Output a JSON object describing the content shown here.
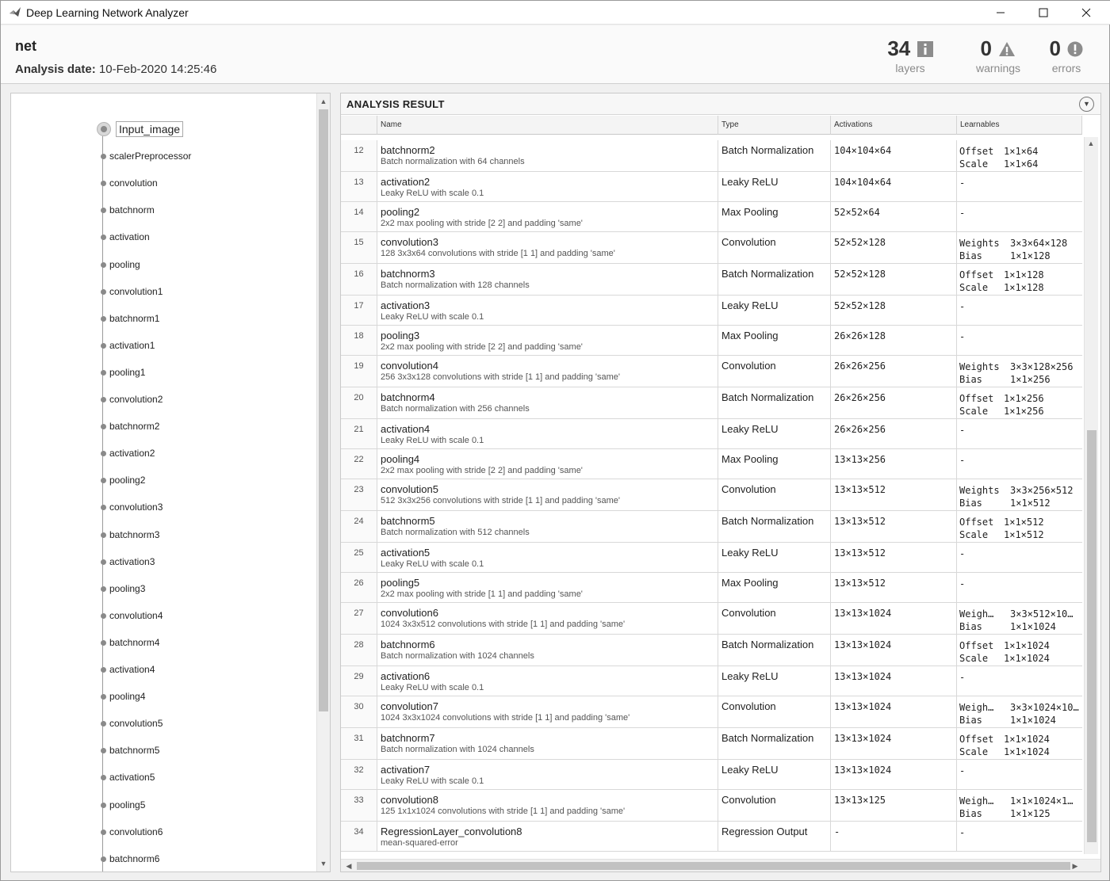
{
  "window": {
    "title": "Deep Learning Network Analyzer"
  },
  "header": {
    "net_name": "net",
    "analysis_date_label": "Analysis date:",
    "analysis_date": "10-Feb-2020 14:25:46",
    "stats": {
      "layers": {
        "value": "34",
        "label": "layers"
      },
      "warnings": {
        "value": "0",
        "label": "warnings"
      },
      "errors": {
        "value": "0",
        "label": "errors"
      }
    }
  },
  "graph": {
    "nodes": [
      "Input_image",
      "scalerPreprocessor",
      "convolution",
      "batchnorm",
      "activation",
      "pooling",
      "convolution1",
      "batchnorm1",
      "activation1",
      "pooling1",
      "convolution2",
      "batchnorm2",
      "activation2",
      "pooling2",
      "convolution3",
      "batchnorm3",
      "activation3",
      "pooling3",
      "convolution4",
      "batchnorm4",
      "activation4",
      "pooling4",
      "convolution5",
      "batchnorm5",
      "activation5",
      "pooling5",
      "convolution6",
      "batchnorm6"
    ]
  },
  "analysis": {
    "title": "ANALYSIS RESULT",
    "columns": {
      "name": "Name",
      "type": "Type",
      "activations": "Activations",
      "learnables": "Learnables"
    },
    "rows": [
      {
        "idx": "12",
        "name": "batchnorm2",
        "desc": "Batch normalization with 64 channels",
        "type": "Batch Normalization",
        "act": "104×104×64",
        "learn": [
          [
            "Offset",
            "1×1×64"
          ],
          [
            "Scale",
            "1×1×64"
          ]
        ]
      },
      {
        "idx": "13",
        "name": "activation2",
        "desc": "Leaky ReLU with scale 0.1",
        "type": "Leaky ReLU",
        "act": "104×104×64",
        "learn": [
          [
            "-",
            ""
          ]
        ]
      },
      {
        "idx": "14",
        "name": "pooling2",
        "desc": "2x2 max pooling with stride [2 2] and padding 'same'",
        "type": "Max Pooling",
        "act": "52×52×64",
        "learn": [
          [
            "-",
            ""
          ]
        ]
      },
      {
        "idx": "15",
        "name": "convolution3",
        "desc": "128 3x3x64 convolutions with stride [1 1] and padding 'same'",
        "type": "Convolution",
        "act": "52×52×128",
        "learn": [
          [
            "Weights",
            "3×3×64×128"
          ],
          [
            "Bias",
            "1×1×128"
          ]
        ]
      },
      {
        "idx": "16",
        "name": "batchnorm3",
        "desc": "Batch normalization with 128 channels",
        "type": "Batch Normalization",
        "act": "52×52×128",
        "learn": [
          [
            "Offset",
            "1×1×128"
          ],
          [
            "Scale",
            "1×1×128"
          ]
        ]
      },
      {
        "idx": "17",
        "name": "activation3",
        "desc": "Leaky ReLU with scale 0.1",
        "type": "Leaky ReLU",
        "act": "52×52×128",
        "learn": [
          [
            "-",
            ""
          ]
        ]
      },
      {
        "idx": "18",
        "name": "pooling3",
        "desc": "2x2 max pooling with stride [2 2] and padding 'same'",
        "type": "Max Pooling",
        "act": "26×26×128",
        "learn": [
          [
            "-",
            ""
          ]
        ]
      },
      {
        "idx": "19",
        "name": "convolution4",
        "desc": "256 3x3x128 convolutions with stride [1 1] and padding 'same'",
        "type": "Convolution",
        "act": "26×26×256",
        "learn": [
          [
            "Weights",
            "3×3×128×256"
          ],
          [
            "Bias",
            "1×1×256"
          ]
        ]
      },
      {
        "idx": "20",
        "name": "batchnorm4",
        "desc": "Batch normalization with 256 channels",
        "type": "Batch Normalization",
        "act": "26×26×256",
        "learn": [
          [
            "Offset",
            "1×1×256"
          ],
          [
            "Scale",
            "1×1×256"
          ]
        ]
      },
      {
        "idx": "21",
        "name": "activation4",
        "desc": "Leaky ReLU with scale 0.1",
        "type": "Leaky ReLU",
        "act": "26×26×256",
        "learn": [
          [
            "-",
            ""
          ]
        ]
      },
      {
        "idx": "22",
        "name": "pooling4",
        "desc": "2x2 max pooling with stride [2 2] and padding 'same'",
        "type": "Max Pooling",
        "act": "13×13×256",
        "learn": [
          [
            "-",
            ""
          ]
        ]
      },
      {
        "idx": "23",
        "name": "convolution5",
        "desc": "512 3x3x256 convolutions with stride [1 1] and padding 'same'",
        "type": "Convolution",
        "act": "13×13×512",
        "learn": [
          [
            "Weights",
            "3×3×256×512"
          ],
          [
            "Bias",
            "1×1×512"
          ]
        ]
      },
      {
        "idx": "24",
        "name": "batchnorm5",
        "desc": "Batch normalization with 512 channels",
        "type": "Batch Normalization",
        "act": "13×13×512",
        "learn": [
          [
            "Offset",
            "1×1×512"
          ],
          [
            "Scale",
            "1×1×512"
          ]
        ]
      },
      {
        "idx": "25",
        "name": "activation5",
        "desc": "Leaky ReLU with scale 0.1",
        "type": "Leaky ReLU",
        "act": "13×13×512",
        "learn": [
          [
            "-",
            ""
          ]
        ]
      },
      {
        "idx": "26",
        "name": "pooling5",
        "desc": "2x2 max pooling with stride [1 1] and padding 'same'",
        "type": "Max Pooling",
        "act": "13×13×512",
        "learn": [
          [
            "-",
            ""
          ]
        ]
      },
      {
        "idx": "27",
        "name": "convolution6",
        "desc": "1024 3x3x512 convolutions with stride [1 1] and padding 'same'",
        "type": "Convolution",
        "act": "13×13×1024",
        "learn": [
          [
            "Weigh…",
            "3×3×512×10…"
          ],
          [
            "Bias",
            "1×1×1024"
          ]
        ]
      },
      {
        "idx": "28",
        "name": "batchnorm6",
        "desc": "Batch normalization with 1024 channels",
        "type": "Batch Normalization",
        "act": "13×13×1024",
        "learn": [
          [
            "Offset",
            "1×1×1024"
          ],
          [
            "Scale",
            "1×1×1024"
          ]
        ]
      },
      {
        "idx": "29",
        "name": "activation6",
        "desc": "Leaky ReLU with scale 0.1",
        "type": "Leaky ReLU",
        "act": "13×13×1024",
        "learn": [
          [
            "-",
            ""
          ]
        ]
      },
      {
        "idx": "30",
        "name": "convolution7",
        "desc": "1024 3x3x1024 convolutions with stride [1 1] and padding 'same'",
        "type": "Convolution",
        "act": "13×13×1024",
        "learn": [
          [
            "Weigh…",
            "3×3×1024×10…"
          ],
          [
            "Bias",
            "1×1×1024"
          ]
        ]
      },
      {
        "idx": "31",
        "name": "batchnorm7",
        "desc": "Batch normalization with 1024 channels",
        "type": "Batch Normalization",
        "act": "13×13×1024",
        "learn": [
          [
            "Offset",
            "1×1×1024"
          ],
          [
            "Scale",
            "1×1×1024"
          ]
        ]
      },
      {
        "idx": "32",
        "name": "activation7",
        "desc": "Leaky ReLU with scale 0.1",
        "type": "Leaky ReLU",
        "act": "13×13×1024",
        "learn": [
          [
            "-",
            ""
          ]
        ]
      },
      {
        "idx": "33",
        "name": "convolution8",
        "desc": "125 1x1x1024 convolutions with stride [1 1] and padding 'same'",
        "type": "Convolution",
        "act": "13×13×125",
        "learn": [
          [
            "Weigh…",
            "1×1×1024×1…"
          ],
          [
            "Bias",
            "1×1×125"
          ]
        ]
      },
      {
        "idx": "34",
        "name": "RegressionLayer_convolution8",
        "desc": "mean-squared-error",
        "type": "Regression Output",
        "act": "-",
        "learn": [
          [
            "-",
            ""
          ]
        ]
      }
    ]
  },
  "icons": {
    "info": "info-icon",
    "warning": "warning-icon",
    "error": "error-icon"
  },
  "colors": {
    "accent_gray": "#888888",
    "background": "#f0f0f0"
  }
}
